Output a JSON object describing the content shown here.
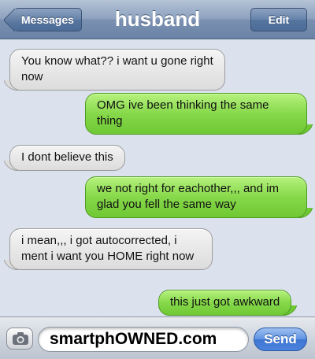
{
  "header": {
    "back_label": "Messages",
    "title": "husband",
    "edit_label": "Edit"
  },
  "messages": [
    {
      "side": "incoming",
      "text": "You know what?? i want u gone right now"
    },
    {
      "side": "outgoing",
      "text": "OMG ive been thinking the same thing"
    },
    {
      "side": "incoming",
      "text": "I dont believe this"
    },
    {
      "side": "outgoing",
      "text": "we not right for eachother,,, and im glad you fell the same way"
    },
    {
      "side": "incoming",
      "text": "i mean,,, i got autocorrected, i ment i want you HOME right now"
    },
    {
      "side": "outgoing",
      "text": "this just got awkward"
    }
  ],
  "input": {
    "value": "smartphOWNED.com",
    "send_label": "Send"
  },
  "icons": {
    "camera": "camera-icon"
  },
  "colors": {
    "incoming_bubble": "#e6e6e6",
    "outgoing_bubble": "#86d84a",
    "header": "#7a90b1",
    "send_button": "#4a82dc"
  }
}
